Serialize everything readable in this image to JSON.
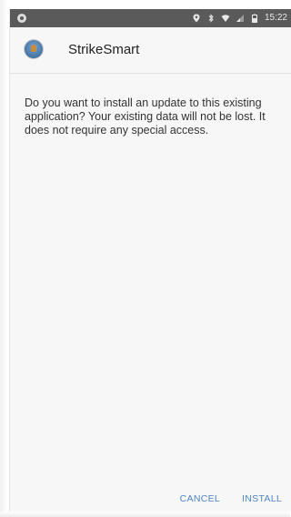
{
  "status_bar": {
    "time": "15:22",
    "icons": [
      "location-icon",
      "bluetooth-icon",
      "wifi-icon",
      "signal-icon",
      "battery-icon"
    ]
  },
  "app": {
    "title": "StrikeSmart"
  },
  "dialog": {
    "message": "Do you want to install an update to this existing application? Your existing data will not be lost. It does not require any special access.",
    "cancel_label": "CANCEL",
    "install_label": "INSTALL"
  },
  "colors": {
    "status_bar_bg": "#5a5a5a",
    "accent": "#4f86c6",
    "background": "#f7f7f7",
    "text": "#333333"
  }
}
